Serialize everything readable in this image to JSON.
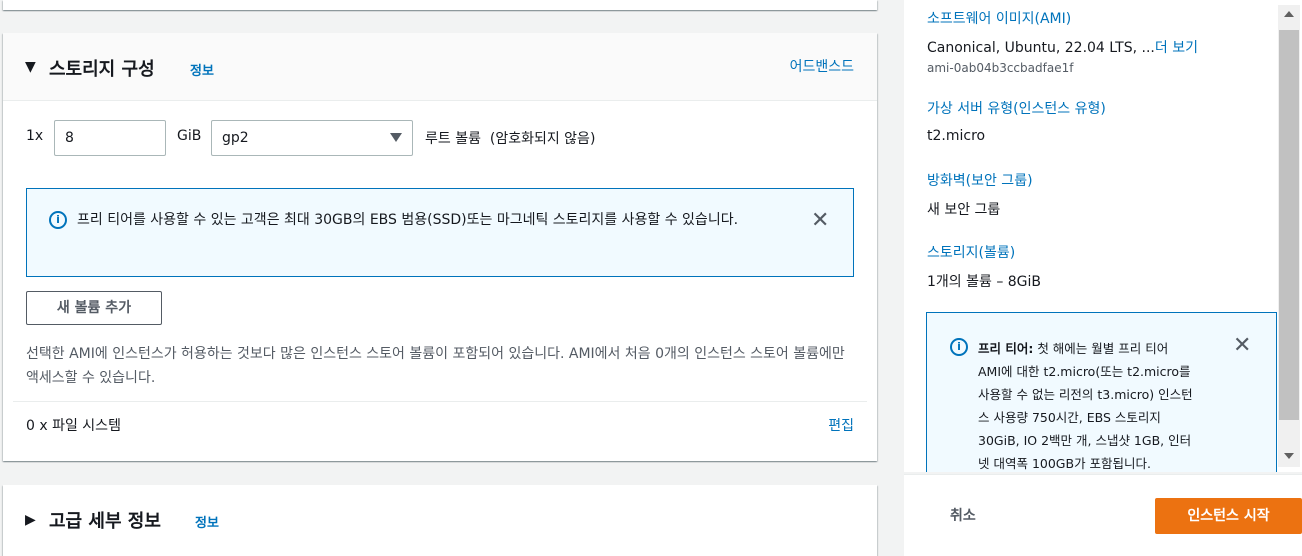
{
  "storage": {
    "title": "스토리지 구성",
    "info": "정보",
    "advanced_link": "어드밴스드",
    "volume": {
      "count_label": "1x",
      "size_value": "8",
      "unit": "GiB",
      "type_value": "gp2",
      "root_desc": "루트 볼륨  (암호화되지 않음)"
    },
    "alert_text": "프리 티어를 사용할 수 있는 고객은 최대 30GB의 EBS 범용(SSD)또는 마그네틱 스토리지를 사용할 수 있습니다.",
    "add_volume_button": "새 볼륨 추가",
    "note": "선택한 AMI에 인스턴스가 허용하는 것보다 많은 인스턴스 스토어 볼륨이 포함되어 있습니다. AMI에서 처음 0개의 인스턴스 스토어 볼륨에만 액세스할 수 있습니다.",
    "file_systems": "0 x 파일 시스템",
    "edit_link": "편집"
  },
  "advanced_details": {
    "title": "고급 세부 정보",
    "info": "정보"
  },
  "summary": {
    "ami_title": "소프트웨어 이미지(AMI)",
    "ami_value": "Canonical, Ubuntu, 22.04 LTS, ...",
    "ami_more": "더 보기",
    "ami_id": "ami-0ab04b3ccbadfae1f",
    "instance_type_title": "가상 서버 유형(인스턴스 유형)",
    "instance_type_value": "t2.micro",
    "firewall_title": "방화벽(보안 그룹)",
    "firewall_value": "새 보안 그룹",
    "storage_title": "스토리지(볼륨)",
    "storage_value": "1개의 볼륨 – 8GiB",
    "free_tier_label": "프리 티어:",
    "free_tier_text": " 첫 해에는 월별 프리 티어 AMI에 대한 t2.micro(또는 t2.micro를 사용할 수 없는 리전의 t3.micro) 인스턴스 사용량 750시간, EBS 스토리지 30GiB, IO 2백만 개, 스냅샷 1GB, 인터넷 대역폭 100GB가 포함됩니다."
  },
  "footer": {
    "cancel": "취소",
    "launch": "인스턴스 시작"
  },
  "icons": {
    "info": "info-circle-icon",
    "close": "close-icon",
    "caret_down": "caret-down-icon",
    "caret_right": "caret-right-icon"
  },
  "colors": {
    "link": "#0073bb",
    "primary_button": "#ec7211",
    "alert_bg": "#f1faff"
  }
}
